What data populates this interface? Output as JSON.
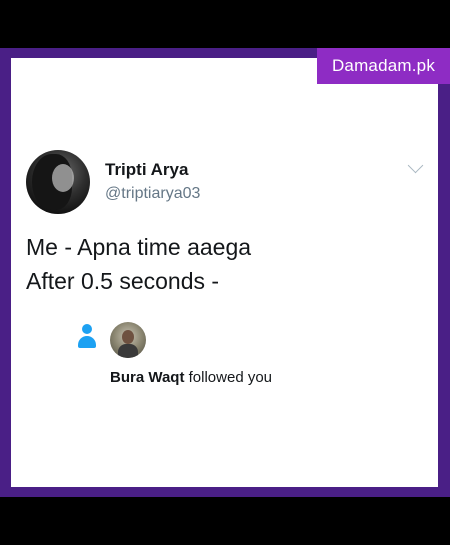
{
  "watermark": "Damadam.pk",
  "tweet": {
    "author_name": "Tripti Arya",
    "author_handle": "@triptiarya03",
    "lines": [
      "Me - Apna time aaega",
      "After 0.5 seconds -"
    ]
  },
  "notification": {
    "user": "Bura Waqt",
    "action": "followed you"
  },
  "colors": {
    "frame": "#4a1f86",
    "watermark_bg": "#8e2cc4",
    "accent": "#1da1f2"
  },
  "icons": [
    "chevron-down-icon",
    "person-icon"
  ]
}
